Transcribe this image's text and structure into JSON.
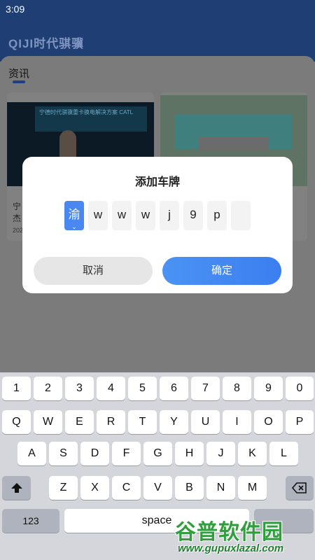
{
  "status_bar": {
    "time": "3:09"
  },
  "header": {
    "logo_text": "QIJI时代骐骥"
  },
  "section": {
    "title": "资讯"
  },
  "cards": [
    {
      "banner": "宁德时代骐骥重卡换电解决方案 CATL",
      "text": "宁\n杰",
      "date": "202"
    },
    {
      "banner": "",
      "text": "",
      "date": ""
    }
  ],
  "dialog": {
    "title": "添加车牌",
    "plate_chars": [
      "渝",
      "w",
      "w",
      "w",
      "j",
      "9",
      "p",
      ""
    ],
    "active_index": 0,
    "cancel_label": "取消",
    "confirm_label": "确定"
  },
  "keyboard": {
    "row_numbers": [
      "1",
      "2",
      "3",
      "4",
      "5",
      "6",
      "7",
      "8",
      "9",
      "0"
    ],
    "row1": [
      "Q",
      "W",
      "E",
      "R",
      "T",
      "Y",
      "U",
      "I",
      "O",
      "P"
    ],
    "row2": [
      "A",
      "S",
      "D",
      "F",
      "G",
      "H",
      "J",
      "K",
      "L"
    ],
    "row3": [
      "Z",
      "X",
      "C",
      "V",
      "B",
      "N",
      "M"
    ],
    "mode_label": "123",
    "space_label": "space"
  },
  "watermark": {
    "name": "谷普软件园",
    "url": "www.gupuxlazal.com"
  },
  "colors": {
    "accent": "#4a87f0",
    "header": "#1f3e73"
  }
}
